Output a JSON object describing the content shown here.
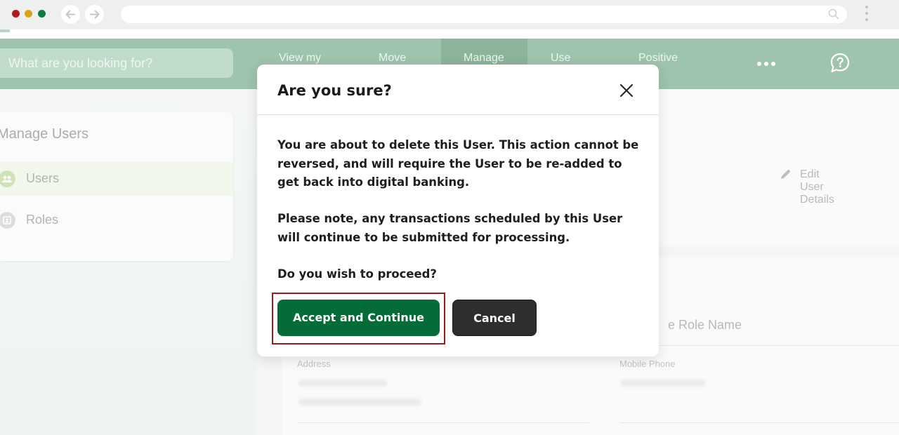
{
  "browser": {
    "dot_colors": [
      "#b01b1b",
      "#d9a51a",
      "#0f7b3c"
    ],
    "back_icon": "arrow-left-icon",
    "forward_icon": "arrow-right-icon"
  },
  "navbar": {
    "search_placeholder": "What are you looking for?",
    "items": [
      {
        "label": "View my"
      },
      {
        "label": "Move"
      },
      {
        "label": "Manage"
      },
      {
        "label": "Use"
      },
      {
        "label": "Positive"
      }
    ],
    "more_icon": "more-horizontal-icon",
    "help_icon": "help-chat-icon"
  },
  "sidebar": {
    "title": "Manage Users",
    "items": [
      {
        "label": "Users",
        "icon": "users-icon",
        "active": true
      },
      {
        "label": "Roles",
        "icon": "roles-icon",
        "active": false
      }
    ]
  },
  "detail": {
    "edit_label": "Edit User Details",
    "role_name_label": "e Role Name",
    "address_label": "Address",
    "mobile_phone_label": "Mobile Phone"
  },
  "modal": {
    "title": "Are you sure?",
    "paragraph_1": "You are about to delete this User. This action cannot be reversed, and will require the User to be re-added to get back into digital banking.",
    "paragraph_2": "Please note, any transactions scheduled by this User will continue to be submitted for processing.",
    "question": "Do you wish to proceed?",
    "accept_label": "Accept and Continue",
    "cancel_label": "Cancel",
    "accept_color": "#066c37",
    "cancel_color": "#2e2e2e",
    "focus_color": "#9b1b1b"
  }
}
